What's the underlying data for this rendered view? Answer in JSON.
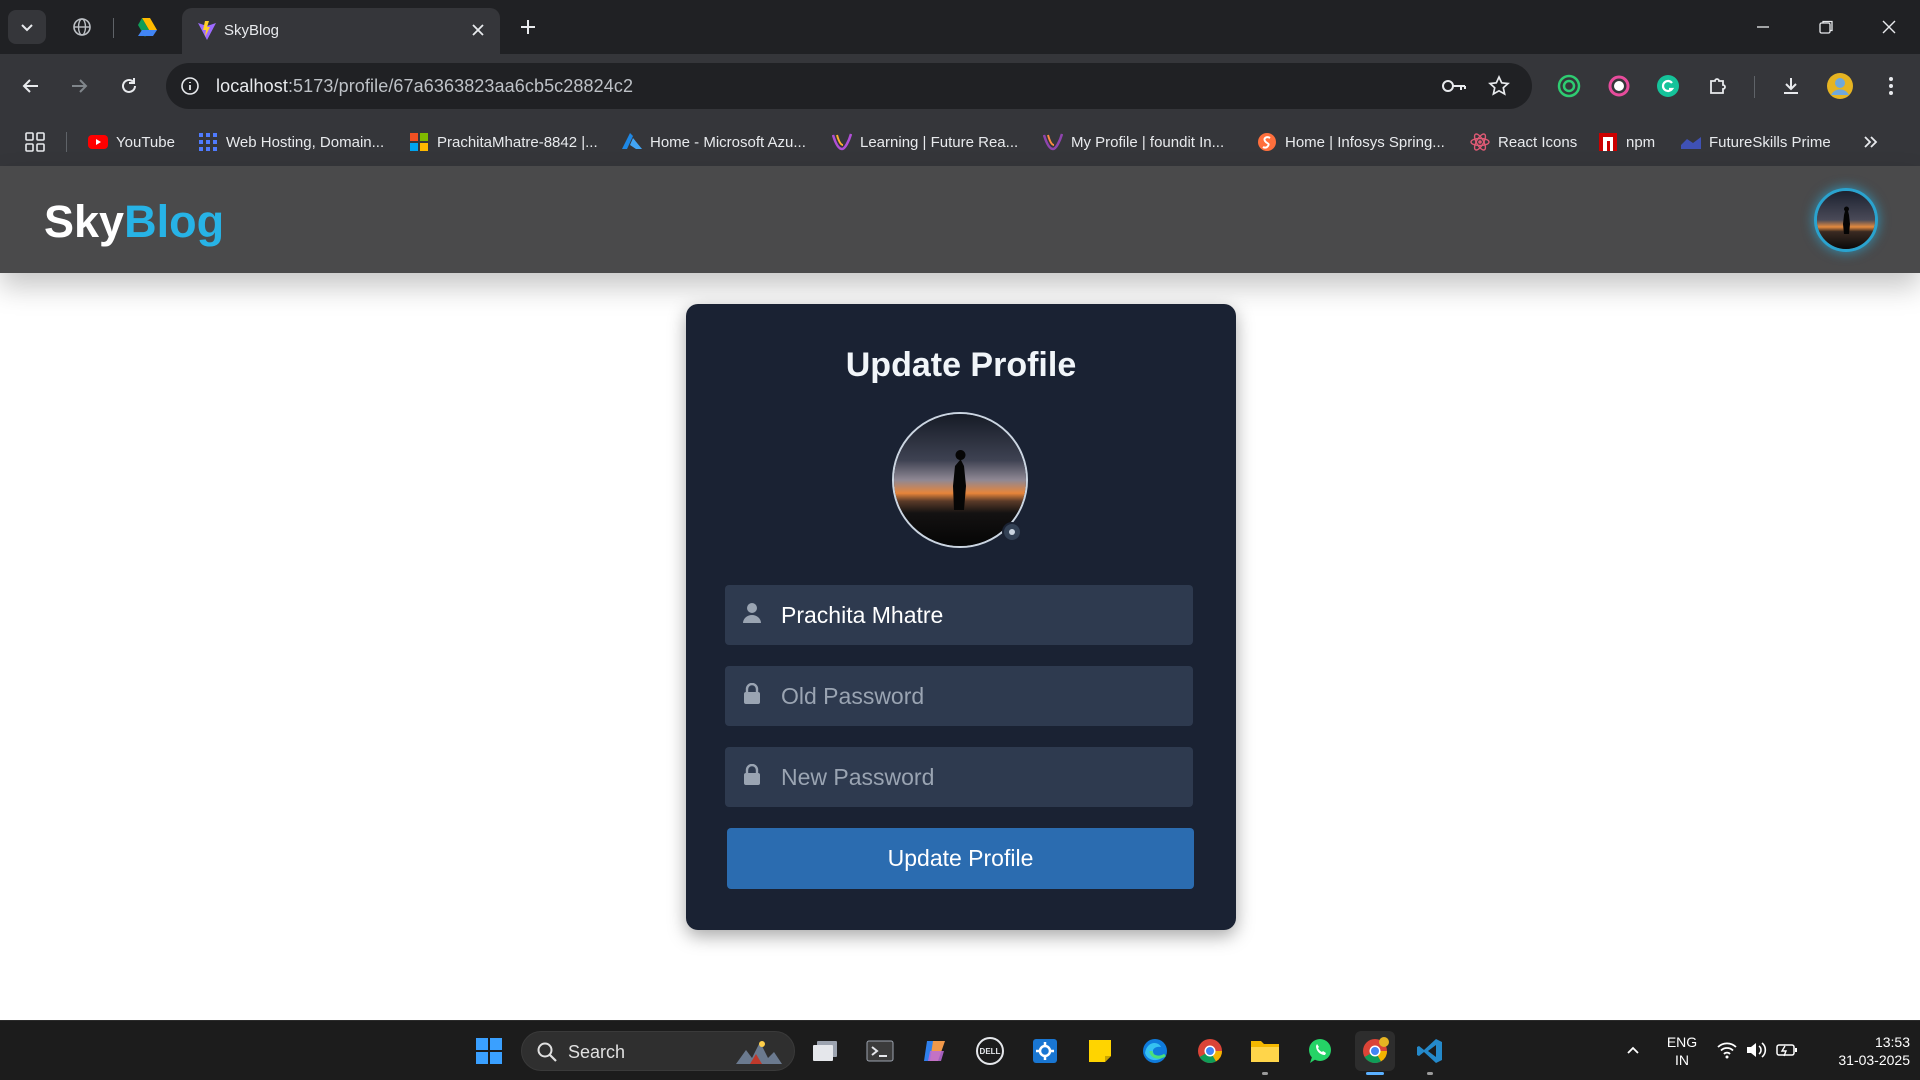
{
  "browser": {
    "active_tab": {
      "title": "SkyBlog"
    },
    "url": {
      "host": "localhost",
      "path": ":5173/profile/67a6363823aa6cb5c28824c2"
    },
    "bookmarks": [
      {
        "label": "YouTube",
        "icon": "youtube-icon"
      },
      {
        "label": "Web Hosting, Domain...",
        "icon": "hosting-icon"
      },
      {
        "label": "PrachitaMhatre-8842 |...",
        "icon": "microsoft-icon"
      },
      {
        "label": "Home - Microsoft Azu...",
        "icon": "azure-icon"
      },
      {
        "label": "Learning | Future Rea...",
        "icon": "future-ready-icon"
      },
      {
        "label": "My Profile | foundit In...",
        "icon": "foundit-icon"
      },
      {
        "label": "Home | Infosys Spring...",
        "icon": "infosys-springboard-icon"
      },
      {
        "label": "React Icons",
        "icon": "react-icon"
      },
      {
        "label": "npm",
        "icon": "npm-icon"
      },
      {
        "label": "FutureSkills Prime",
        "icon": "futureskills-icon"
      }
    ]
  },
  "app": {
    "logo": {
      "part1": "Sky",
      "part2": "Blog"
    },
    "colors": {
      "header_bg": "#4a4a4b",
      "logo_accent": "#27b3e6",
      "card_bg": "#1a2233",
      "field_bg": "#2e3a4f",
      "button_bg": "#2b6cb0"
    }
  },
  "form": {
    "title": "Update Profile",
    "name_value": "Prachita Mhatre",
    "old_password_placeholder": "Old Password",
    "new_password_placeholder": "New Password",
    "submit_label": "Update Profile"
  },
  "taskbar": {
    "search_label": "Search",
    "language": {
      "line1": "ENG",
      "line2": "IN"
    },
    "time": "13:53",
    "date": "31-03-2025"
  }
}
